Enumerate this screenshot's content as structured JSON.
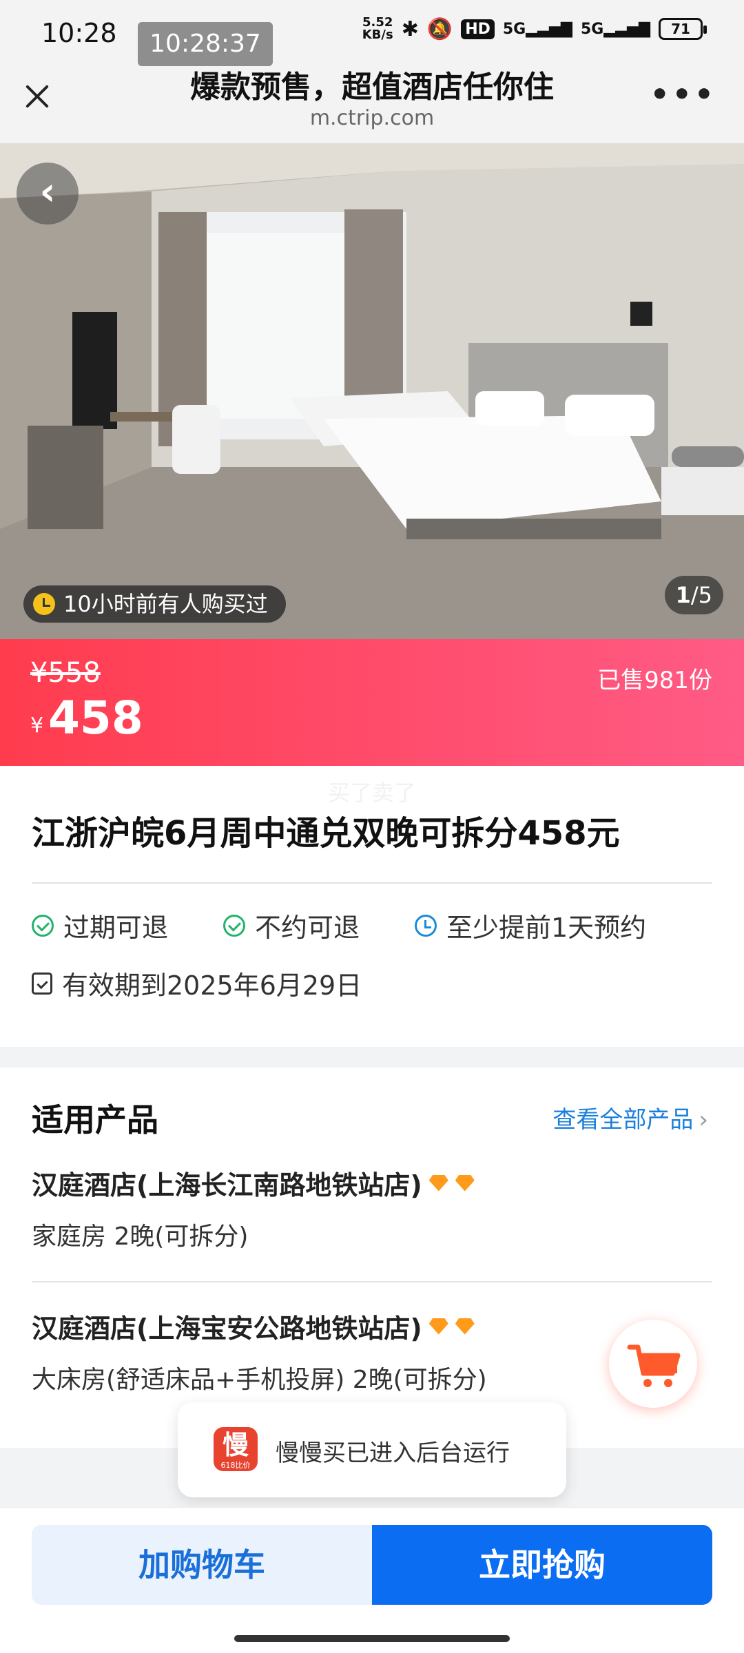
{
  "status_bar": {
    "time": "10:28",
    "overlay_time": "10:28:37",
    "net_speed_value": "5.52",
    "net_speed_unit": "KB/s",
    "network_1": "5G",
    "network_2": "5G",
    "battery": "71"
  },
  "browser": {
    "title": "爆款预售，超值酒店任你住",
    "url": "m.ctrip.com"
  },
  "gallery": {
    "recent_purchase": "10小时前有人购买过",
    "current_index": "1",
    "total": "/5"
  },
  "price": {
    "original": "¥558",
    "currency": "¥",
    "current": "458",
    "sold": "已售981份"
  },
  "product": {
    "watermark": "买了卖了",
    "title": "江浙沪皖6月周中通兑双晚可拆分458元",
    "tags": [
      "过期可退",
      "不约可退",
      "至少提前1天预约"
    ],
    "validity": "有效期到2025年6月29日"
  },
  "applicable": {
    "section_title": "适用产品",
    "view_all": "查看全部产品",
    "hotels": [
      {
        "name": "汉庭酒店(上海长江南路地铁站店)",
        "room": "家庭房 2晚(可拆分)"
      },
      {
        "name": "汉庭酒店(上海宝安公路地铁站店)",
        "room": "大床房(舒适床品+手机投屏) 2晚(可拆分)"
      }
    ]
  },
  "toast": {
    "logo_char": "慢",
    "logo_sub": "618比价",
    "text": "慢慢买已进入后台运行"
  },
  "actions": {
    "add_to_cart": "加购物车",
    "buy_now": "立即抢购"
  },
  "colors": {
    "accent_blue": "#0a6df2",
    "price_gradient_start": "#ff3c4e",
    "price_gradient_end": "#ff5b86",
    "diamond": "#ff9a1a"
  }
}
